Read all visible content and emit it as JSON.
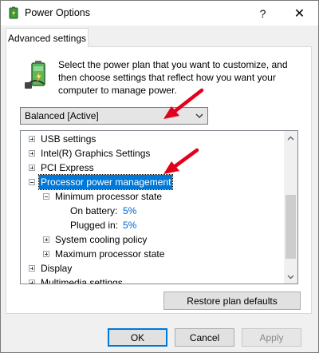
{
  "window": {
    "title": "Power Options",
    "help_label": "?",
    "close_label": "✕"
  },
  "tab": {
    "label": "Advanced settings"
  },
  "intro": {
    "text": "Select the power plan that you want to customize, and then choose settings that reflect how you want your computer to manage power."
  },
  "plan_select": {
    "value": "Balanced [Active]"
  },
  "tree": {
    "usb": "USB settings",
    "intel_graphics": "Intel(R) Graphics Settings",
    "pci_express": "PCI Express",
    "processor": "Processor power management",
    "min_state": "Minimum processor state",
    "on_battery_label": "On battery:",
    "on_battery_value": "5%",
    "plugged_in_label": "Plugged in:",
    "plugged_in_value": "5%",
    "cooling": "System cooling policy",
    "max_state": "Maximum processor state",
    "display": "Display",
    "multimedia": "Multimedia settings"
  },
  "buttons": {
    "restore": "Restore plan defaults",
    "ok": "OK",
    "cancel": "Cancel",
    "apply": "Apply"
  },
  "colors": {
    "selection": "#0078d7",
    "link_value": "#0066cc",
    "annotation_arrow": "#e3001b"
  },
  "icons": {
    "title": "power-options-icon",
    "intro": "battery-plug-icon",
    "dropdown": "chevron-down-icon"
  }
}
